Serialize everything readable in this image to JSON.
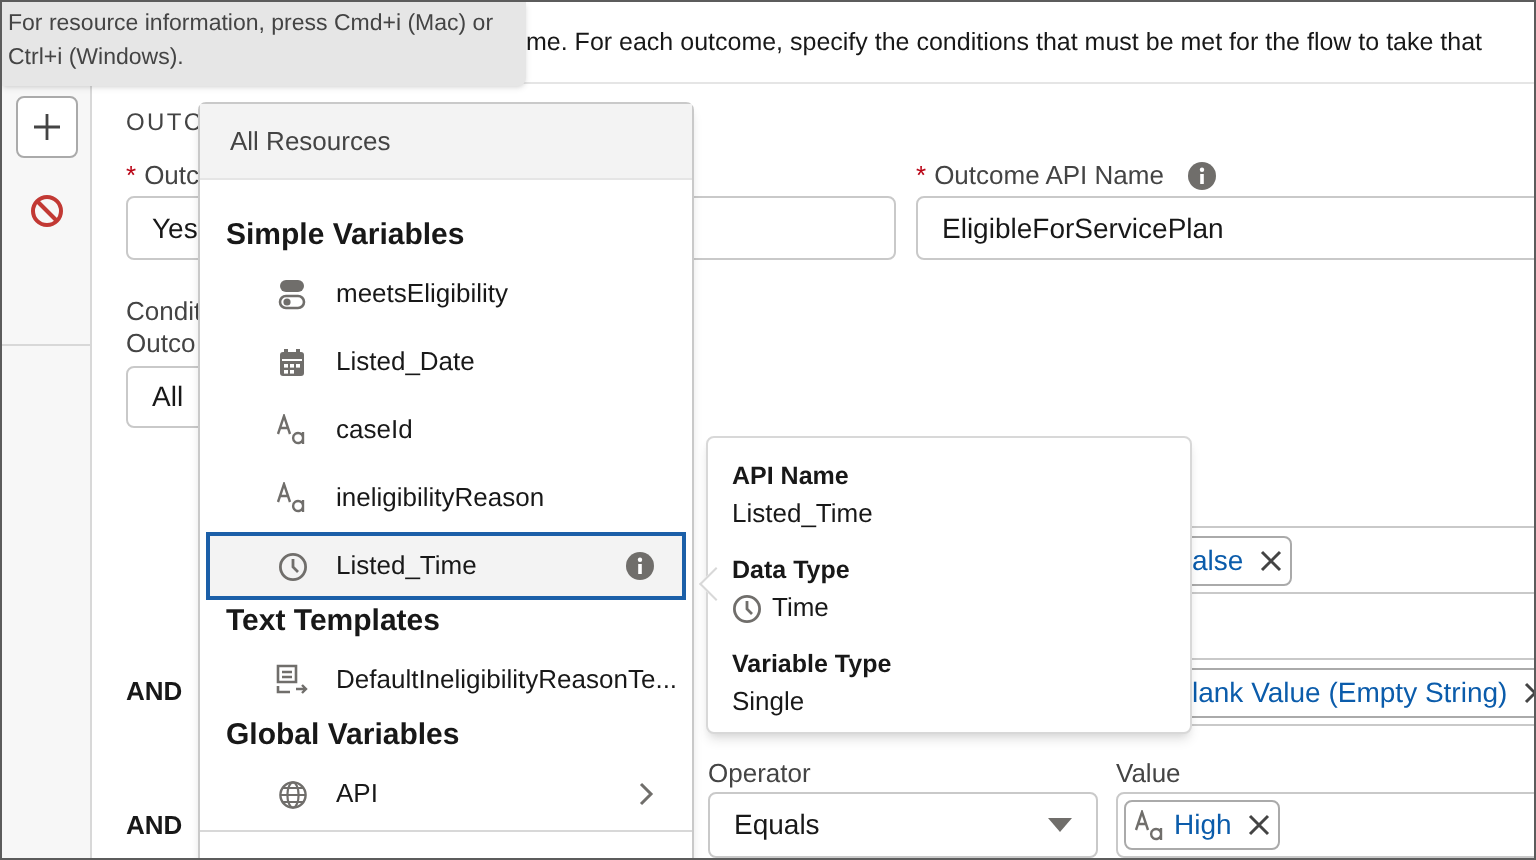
{
  "tooltip": {
    "text_line_1": "For resource information, press Cmd+i (Mac) or",
    "text_line_2": "Ctrl+i (Windows)."
  },
  "header": {
    "description": "me. For each outcome, specify the conditions that must be met for the flow to take that"
  },
  "outcome": {
    "section_label": "OUTC",
    "required_mark": "*",
    "fields": [
      {
        "label": "Outc",
        "required": true,
        "info": false,
        "value": "Yes"
      },
      {
        "label": "Outcome API Name",
        "required": true,
        "info": true,
        "value": "EligibleForServicePlan"
      }
    ],
    "condition_label_1": "Condit",
    "condition_label_2": "Outco",
    "condition_requirement": "All"
  },
  "condition_rows": [
    {
      "kind": "value_only",
      "value_pill": "alse"
    },
    {
      "kind": "value_only",
      "connector": "AND",
      "value_pill": "lank Value (Empty String)"
    },
    {
      "kind": "full",
      "connector": "AND",
      "operator_label": "Operator",
      "operator": "Equals",
      "value_label": "Value",
      "value_pill": "High"
    }
  ],
  "resource_menu": {
    "header": "All Resources",
    "groups": [
      {
        "title": "Simple Variables",
        "items": [
          {
            "label": "meetsEligibility",
            "kind": "boolean",
            "selected": false,
            "submenu": false
          },
          {
            "label": "Listed_Date",
            "kind": "date",
            "selected": false,
            "submenu": false
          },
          {
            "label": "caseId",
            "kind": "text",
            "selected": false,
            "submenu": false
          },
          {
            "label": "ineligibilityReason",
            "kind": "text",
            "selected": false,
            "submenu": false
          },
          {
            "label": "Listed_Time",
            "kind": "time",
            "selected": true,
            "submenu": false
          }
        ]
      },
      {
        "title": "Text Templates",
        "items": [
          {
            "label": "DefaultIneligibilityReasonTe...",
            "kind": "template",
            "selected": false,
            "submenu": false
          }
        ]
      },
      {
        "title": "Global Variables",
        "items": [
          {
            "label": "API",
            "kind": "globe",
            "selected": false,
            "submenu": true
          }
        ]
      }
    ]
  },
  "resource_popover": {
    "fields": [
      {
        "label": "API Name",
        "value": "Listed_Time"
      },
      {
        "label": "Data Type",
        "value": "Time",
        "kind": "time"
      },
      {
        "label": "Variable Type",
        "value": "Single"
      }
    ]
  }
}
